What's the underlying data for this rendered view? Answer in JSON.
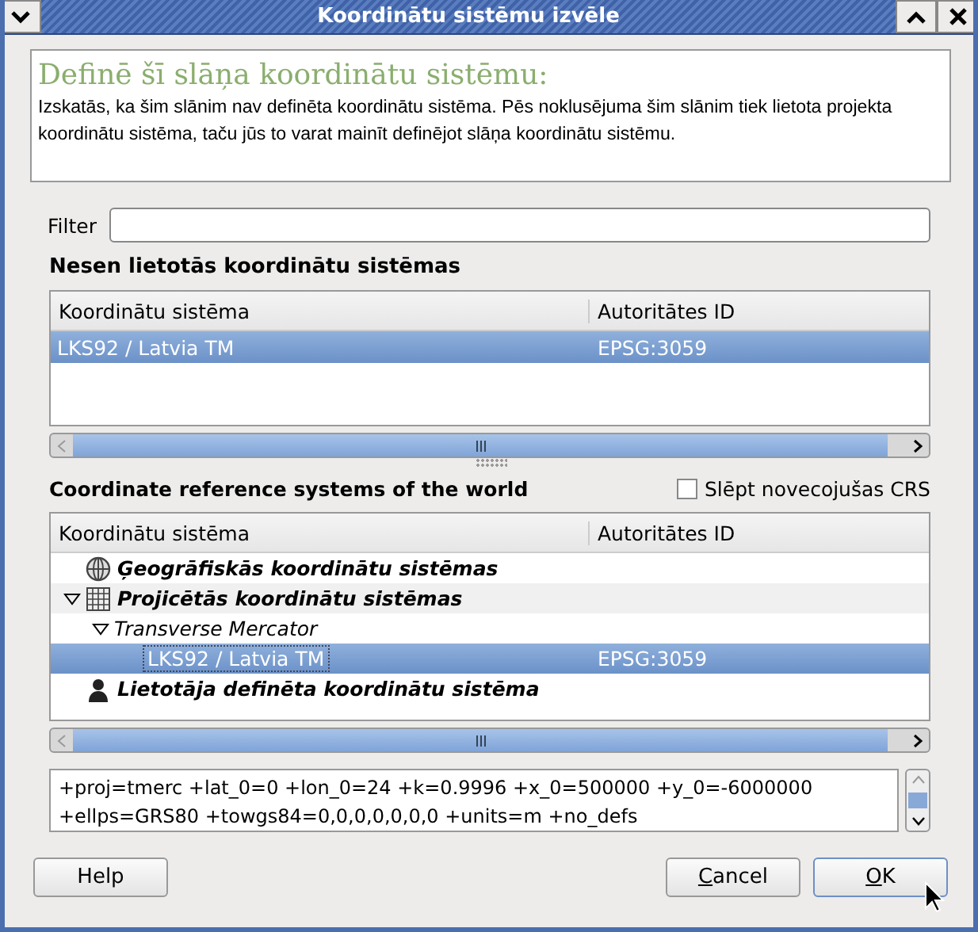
{
  "window": {
    "title": "Koordinātu sistēmu izvēle"
  },
  "info": {
    "heading": "Definē šī slāņa koordinātu sistēmu:",
    "text": "Izskatās, ka šim slānim nav definēta koordinātu sistēma. Pēs noklusējuma šim slānim tiek lietota projekta koordinātu sistēma, taču jūs to varat mainīt definējot slāņa koordinātu sistēmu."
  },
  "filter": {
    "label": "Filter"
  },
  "recent": {
    "heading": "Nesen lietotās koordinātu sistēmas",
    "columns": [
      "Koordinātu sistēma",
      "Autoritātes ID"
    ],
    "rows": [
      {
        "name": "LKS92 / Latvia TM",
        "id": "EPSG:3059",
        "selected": true
      }
    ]
  },
  "world": {
    "heading": "Coordinate reference systems of the world",
    "hide_deprecated": {
      "label": "Slēpt novecojušas CRS",
      "checked": false
    },
    "columns": [
      "Koordinātu sistēma",
      "Autoritātes ID"
    ],
    "tree": [
      {
        "name": "Ģeogrāfiskās koordinātu sistēmas",
        "kind": "geographic",
        "selected": false
      },
      {
        "name": "Projicētās koordinātu sistēmas",
        "kind": "projected",
        "expanded": true,
        "selected": false,
        "children": [
          {
            "name": "Transverse Mercator",
            "expanded": true,
            "selected": false,
            "children": [
              {
                "name": "LKS92 / Latvia TM",
                "id": "EPSG:3059",
                "selected": true
              }
            ]
          }
        ]
      },
      {
        "name": "Lietotāja definēta koordinātu sistēma",
        "kind": "user_defined",
        "selected": false
      }
    ]
  },
  "proj_text": "+proj=tmerc +lat_0=0 +lon_0=24 +k=0.9996 +x_0=500000 +y_0=-6000000 +ellps=GRS80 +towgs84=0,0,0,0,0,0,0 +units=m +no_defs",
  "buttons": [
    {
      "label": "Help",
      "mnemonic": false,
      "default": false
    },
    {
      "label": "Cancel",
      "mnemonic": true,
      "default": false
    },
    {
      "label": "OK",
      "mnemonic": true,
      "default": true
    }
  ]
}
